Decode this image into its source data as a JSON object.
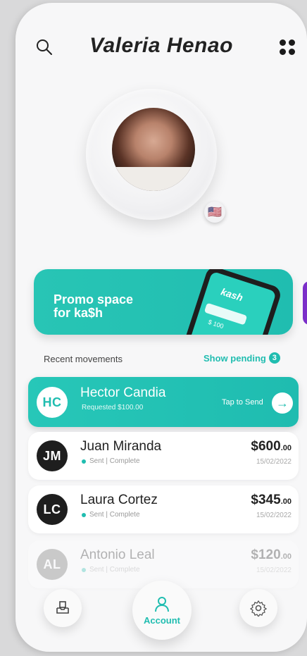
{
  "header": {
    "title": "Valeria Henao",
    "search_icon": "search-icon",
    "menu_icon": "grid-dots-icon"
  },
  "profile": {
    "flag": "🇺🇸"
  },
  "promo": {
    "text_line1": "Promo space",
    "text_line2": "for ka$h",
    "phone_brand": "kash",
    "phone_amount": "$ 100"
  },
  "recent": {
    "label": "Recent movements",
    "pending_label": "Show pending",
    "pending_count": "3"
  },
  "highlight": {
    "initials": "HC",
    "name": "Hector Candia",
    "subtitle": "Requested $100.00",
    "tap_label": "Tap to Send",
    "arrow": "→"
  },
  "movements": [
    {
      "initials": "JM",
      "name": "Juan Miranda",
      "status": "Sent | Complete",
      "amount_main": "$600",
      "amount_cents": ".00",
      "date": "15/02/2022"
    },
    {
      "initials": "LC",
      "name": "Laura Cortez",
      "status": "Sent | Complete",
      "amount_main": "$345",
      "amount_cents": ".00",
      "date": "15/02/2022"
    },
    {
      "initials": "AL",
      "name": "Antonio Leal",
      "status": "Sent | Complete",
      "amount_main": "$120",
      "amount_cents": ".00",
      "date": "15/02/2022"
    }
  ],
  "bottom_nav": {
    "center_label": "Account"
  },
  "colors": {
    "accent": "#20bdb0",
    "dark": "#1e1e1e",
    "promo_next": "#7b2fc9"
  }
}
